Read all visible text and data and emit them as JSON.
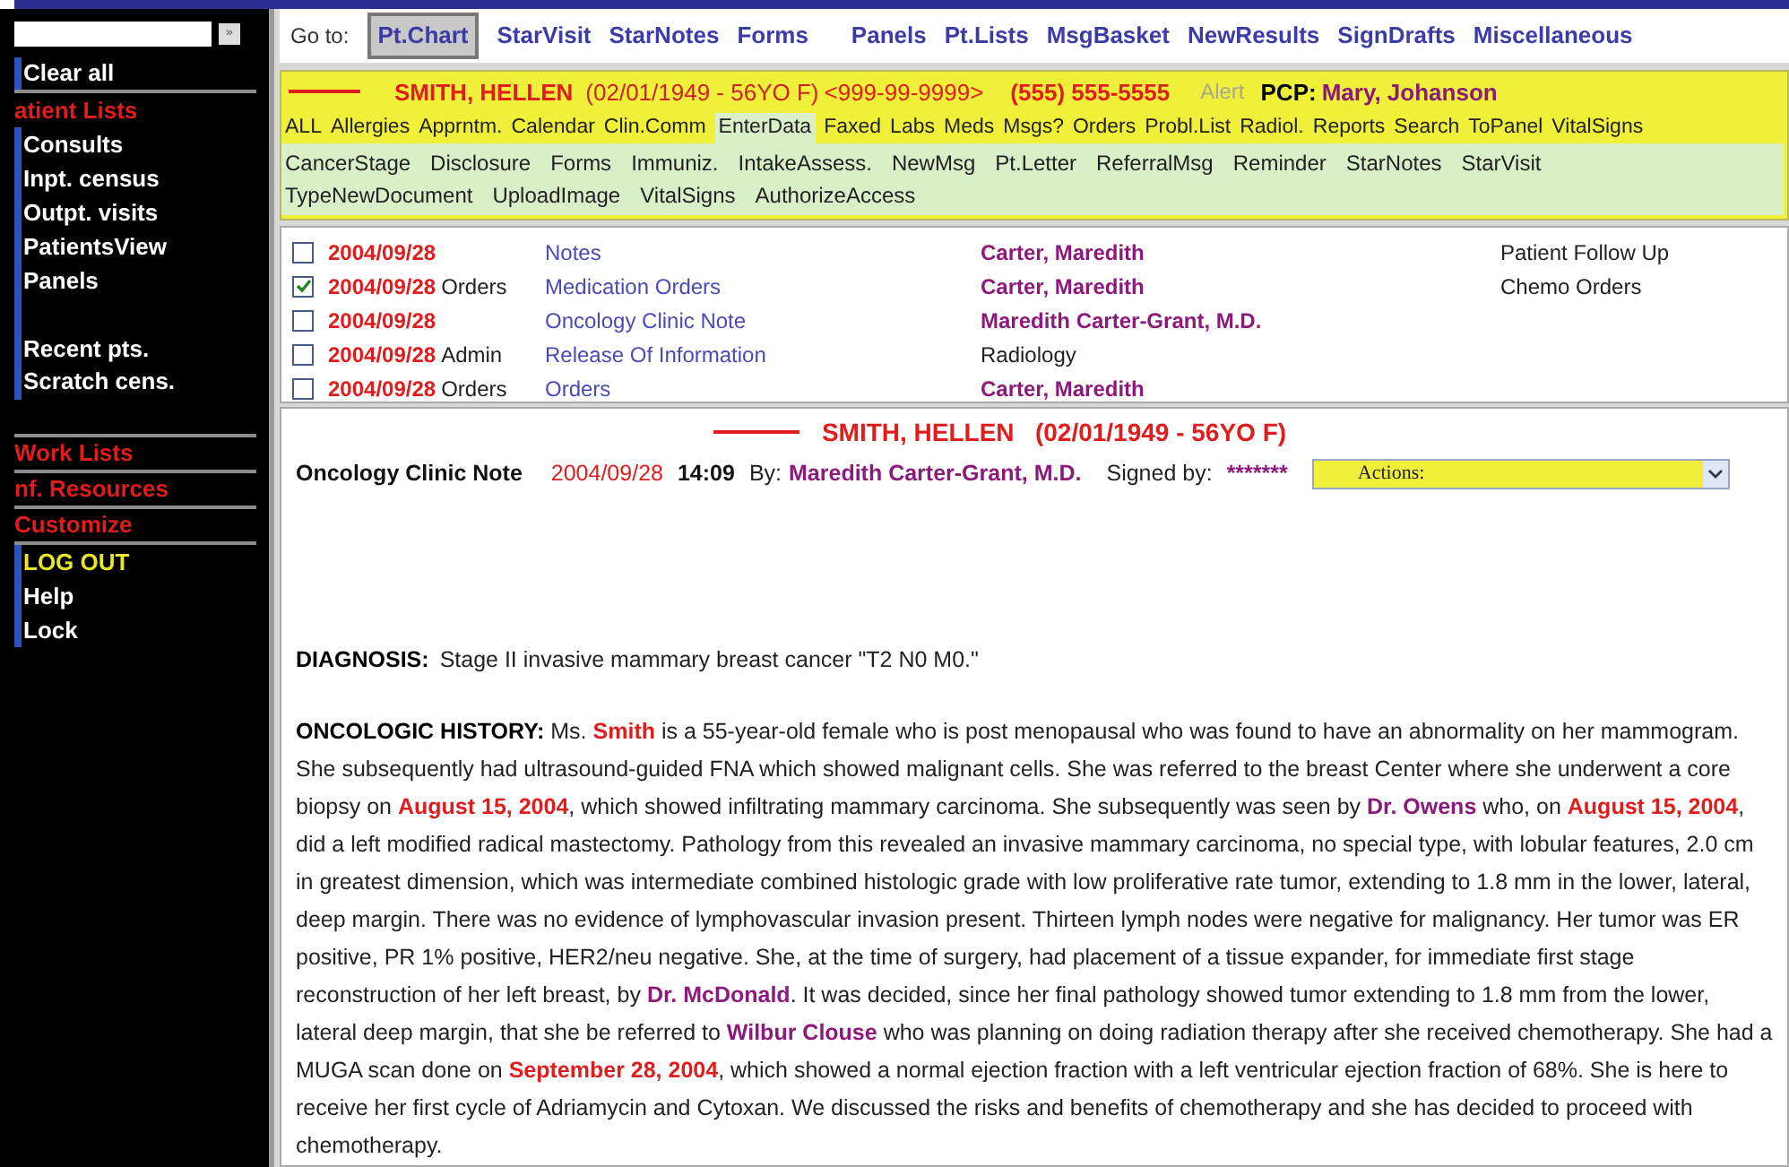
{
  "sidebar": {
    "search": {
      "button": "»"
    },
    "items": [
      {
        "label": "Clear all",
        "kind": "item",
        "divider_after": true
      },
      {
        "label": "atient Lists",
        "kind": "section",
        "divider_after": false
      },
      {
        "label": "Consults",
        "kind": "item",
        "divider_after": false
      },
      {
        "label": "Inpt. census",
        "kind": "item",
        "divider_after": false
      },
      {
        "label": "Outpt. visits",
        "kind": "item",
        "divider_after": false
      },
      {
        "label": "PatientsView",
        "kind": "item",
        "divider_after": false
      },
      {
        "label": "Panels",
        "kind": "item",
        "divider_after": false
      },
      {
        "kind": "blank",
        "divider_after": false
      },
      {
        "label": "Recent pts.",
        "kind": "item",
        "divider_after": false
      },
      {
        "label": "Scratch cens.",
        "kind": "item",
        "divider_after": true
      },
      {
        "label": "Work Lists",
        "kind": "section",
        "divider_after": true
      },
      {
        "label": "nf. Resources",
        "kind": "section",
        "divider_after": true
      },
      {
        "label": "Customize",
        "kind": "section",
        "divider_after": true
      },
      {
        "label": "LOG OUT",
        "kind": "logout",
        "divider_after": false
      },
      {
        "label": "Help",
        "kind": "item",
        "divider_after": false
      },
      {
        "label": "Lock",
        "kind": "item",
        "divider_after": false
      }
    ]
  },
  "goto": {
    "label": "Go to:",
    "links": [
      {
        "label": "Pt.Chart",
        "selected": true
      },
      {
        "label": "StarVisit",
        "selected": false
      },
      {
        "label": "StarNotes",
        "selected": false
      },
      {
        "label": "Forms",
        "selected": false
      },
      {
        "label": "Panels",
        "selected": false
      },
      {
        "label": "Pt.Lists",
        "selected": false
      },
      {
        "label": "MsgBasket",
        "selected": false
      },
      {
        "label": "NewResults",
        "selected": false
      },
      {
        "label": "SignDrafts",
        "selected": false
      },
      {
        "label": "Miscellaneous",
        "selected": false
      }
    ]
  },
  "patient": {
    "name": "SMITH, HELLEN",
    "dob": "(02/01/1949 - 56YO F)",
    "id": "<999-99-9999>",
    "phone": "(555) 555-5555",
    "alert": "Alert",
    "pcp_label": "PCP:",
    "pcp": "Mary, Johanson"
  },
  "chart_tabs": [
    {
      "label": "ALL",
      "highlighted": false
    },
    {
      "label": "Allergies",
      "highlighted": false
    },
    {
      "label": "Apprntm.",
      "highlighted": false
    },
    {
      "label": "Calendar",
      "highlighted": false
    },
    {
      "label": "Clin.Comm",
      "highlighted": false
    },
    {
      "label": "EnterData",
      "highlighted": true
    },
    {
      "label": "Faxed",
      "highlighted": false
    },
    {
      "label": "Labs",
      "highlighted": false
    },
    {
      "label": "Meds",
      "highlighted": false
    },
    {
      "label": "Msgs?",
      "highlighted": false
    },
    {
      "label": "Orders",
      "highlighted": false
    },
    {
      "label": "Probl.List",
      "highlighted": false
    },
    {
      "label": "Radiol.",
      "highlighted": false
    },
    {
      "label": "Reports",
      "highlighted": false
    },
    {
      "label": "Search",
      "highlighted": false
    },
    {
      "label": "ToPanel",
      "highlighted": false
    },
    {
      "label": "VitalSigns",
      "highlighted": false
    }
  ],
  "action_tabs": [
    "CancerStage",
    "Disclosure",
    "Forms",
    "Immuniz.",
    "IntakeAssess.",
    "NewMsg",
    "Pt.Letter",
    "ReferralMsg",
    "Reminder",
    "StarNotes",
    "StarVisit",
    "TypeNewDocument",
    "UploadImage",
    "VitalSigns",
    "AuthorizeAccess"
  ],
  "documents": [
    {
      "checked": false,
      "date": "2004/09/28",
      "title": "Notes",
      "author": "Carter, Maredith",
      "author_bold": true,
      "note": "Patient Follow Up"
    },
    {
      "checked": true,
      "date": "2004/09/28",
      "type": "Orders",
      "title": "Medication Orders",
      "author": "Carter, Maredith",
      "author_bold": true,
      "note": "Chemo Orders"
    },
    {
      "checked": false,
      "date": "2004/09/28",
      "title": "Oncology Clinic Note",
      "author": "Maredith Carter-Grant, M.D.",
      "author_bold": true
    },
    {
      "checked": false,
      "date": "2004/09/28",
      "type": "Admin",
      "title": "Release Of Information",
      "author": "Radiology",
      "author_bold": false
    },
    {
      "checked": false,
      "date": "2004/09/28",
      "type": "Orders",
      "title": "Orders",
      "author": "Carter, Maredith",
      "author_bold": true
    }
  ],
  "note": {
    "header": "SMITH, HELLEN   (02/01/1949 - 56YO F)",
    "title": "Oncology Clinic Note",
    "date": "2004/09/28",
    "time": "14:09",
    "by_label": "By:",
    "author": "Maredith Carter-Grant, M.D.",
    "signed_label": "Signed by:",
    "signature": "*******",
    "actions": "Actions:",
    "diagnosis_label": "DIAGNOSIS:",
    "diagnosis": "Stage II invasive mammary breast cancer \"T2 N0 M0.\"",
    "history_label": "ONCOLOGIC HISTORY:",
    "history": [
      {
        "kind": "plain",
        "text": " Ms. "
      },
      {
        "kind": "emphasis",
        "text": "Smith"
      },
      {
        "kind": "plain",
        "text": " is a 55-year-old female who is post menopausal who was found to have an abnormality on her mammogram. She subsequently had ultrasound-guided FNA which showed malignant cells. She was referred to the breast Center where she underwent a core biopsy on "
      },
      {
        "kind": "emphasis",
        "text": "August 15, 2004"
      },
      {
        "kind": "plain",
        "text": ", which showed infiltrating mammary carcinoma. She subsequently was seen by "
      },
      {
        "kind": "doctor",
        "text": "Dr. Owens"
      },
      {
        "kind": "plain",
        "text": " who, on "
      },
      {
        "kind": "emphasis",
        "text": "August 15, 2004"
      },
      {
        "kind": "plain",
        "text": ", did a left modified radical mastectomy. Pathology from this revealed an invasive mammary carcinoma, no special type, with lobular features, 2.0 cm in greatest dimension, which was intermediate combined histologic grade with low proliferative rate tumor, extending to 1.8 mm in the lower, lateral, deep margin. There was no evidence of lymphovascular invasion present. Thirteen lymph nodes were negative for malignancy. Her tumor was ER positive, PR 1% positive, HER2/neu negative. She, at the time of surgery, had placement of a tissue expander, for immediate first stage reconstruction of her left breast, by "
      },
      {
        "kind": "doctor",
        "text": "Dr. McDonald"
      },
      {
        "kind": "plain",
        "text": ". It was decided, since her final pathology showed tumor extending to 1.8 mm from the lower, lateral deep margin, that she be referred to "
      },
      {
        "kind": "doctor",
        "text": "Wilbur Clouse"
      },
      {
        "kind": "plain",
        "text": " who was planning on doing radiation therapy after she received chemotherapy. She had a MUGA scan done on "
      },
      {
        "kind": "emphasis",
        "text": "September 28, 2004"
      },
      {
        "kind": "plain",
        "text": ", which showed a normal ejection fraction with a left ventricular ejection fraction of 68%. She is here to receive her first cycle of Adriamycin and Cytoxan. We discussed the risks and benefits of chemotherapy and she has decided to proceed with chemotherapy."
      }
    ]
  }
}
